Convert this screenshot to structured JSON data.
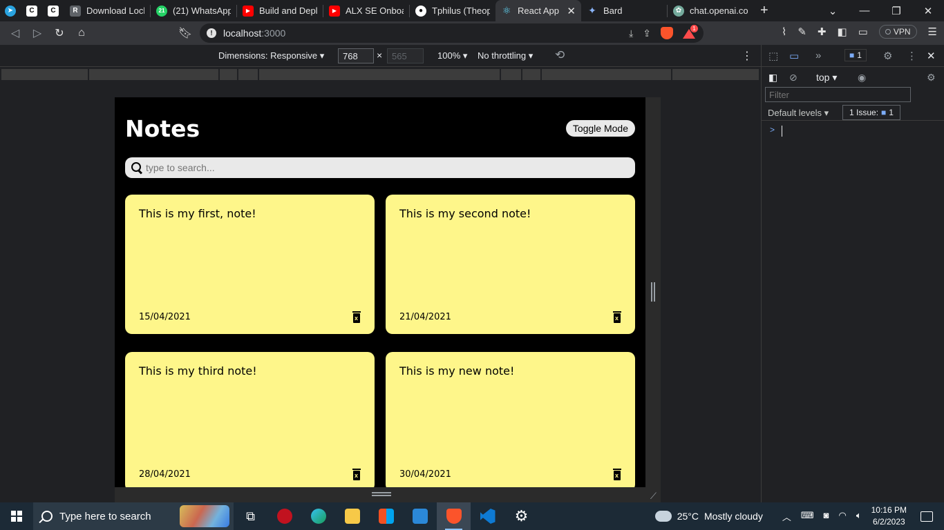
{
  "browser": {
    "tabs": [
      {
        "title": "",
        "icon": "telegram-icon",
        "color": "#2aa3df",
        "pinned": true
      },
      {
        "title": "",
        "icon": "c-icon",
        "color": "#ffffff",
        "pinned": true
      },
      {
        "title": "",
        "icon": "c-icon",
        "color": "#ffffff",
        "pinned": true
      },
      {
        "title": "Download LockD",
        "icon": "r-icon",
        "color": "#5f6368"
      },
      {
        "title": "(21) WhatsApp",
        "icon": "whatsapp-icon",
        "color": "#25d366"
      },
      {
        "title": "Build and Deploy",
        "icon": "youtube-icon",
        "color": "#ff0000"
      },
      {
        "title": "ALX SE Onboardi",
        "icon": "youtube-icon",
        "color": "#ff0000"
      },
      {
        "title": "Tphilus (Theophi",
        "icon": "github-icon",
        "color": "#ffffff"
      },
      {
        "title": "React App",
        "icon": "react-icon",
        "color": "#61dafb",
        "active": true
      },
      {
        "title": "Bard",
        "icon": "bard-icon",
        "color": "#8ab4f8"
      },
      {
        "title": "chat.openai.com",
        "icon": "openai-icon",
        "color": "#74aa9c"
      }
    ],
    "url_host": "localhost",
    "url_port": ":3000",
    "vpn_label": "VPN",
    "rewards_badge": "1"
  },
  "device_toolbar": {
    "dimensions_label": "Dimensions: Responsive",
    "width": "768",
    "times": "×",
    "height_placeholder": "565",
    "zoom": "100%",
    "throttle": "No throttling"
  },
  "app": {
    "title": "Notes",
    "toggle_label": "Toggle Mode",
    "search_placeholder": "type to search...",
    "notes": [
      {
        "text": "This is my first, note!",
        "date": "15/04/2021"
      },
      {
        "text": "This is my second note!",
        "date": "21/04/2021"
      },
      {
        "text": "This is my third note!",
        "date": "28/04/2021"
      },
      {
        "text": "This is my new note!",
        "date": "30/04/2021"
      }
    ],
    "note_color": "#fef68a"
  },
  "devtools": {
    "issues_count": "1",
    "context": "top",
    "filter_placeholder": "Filter",
    "levels_label": "Default levels",
    "issue_chip_label": "1 Issue:",
    "issue_chip_count": "1",
    "prompt": ">"
  },
  "taskbar": {
    "search_placeholder": "Type here to search",
    "weather_temp": "25°C",
    "weather_desc": "Mostly cloudy",
    "time": "10:16 PM",
    "date": "6/2/2023"
  }
}
